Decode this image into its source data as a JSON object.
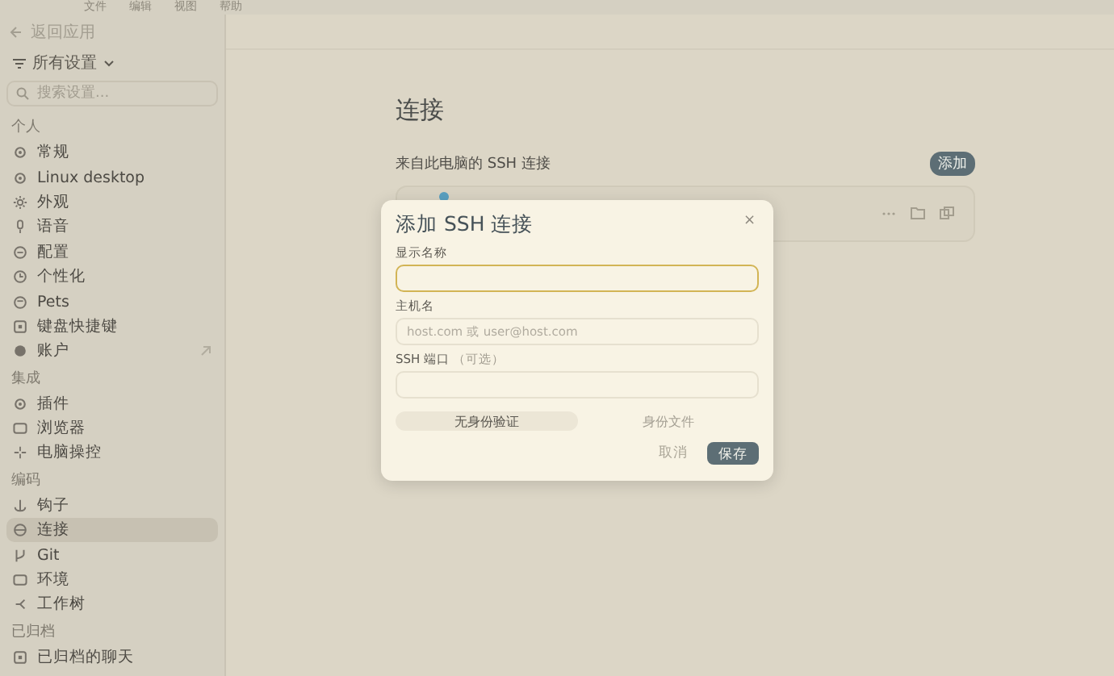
{
  "menu_bar": [
    "文件",
    "编辑",
    "视图",
    "帮助"
  ],
  "sidebar": {
    "back": "返回应用",
    "scope": "所有设置",
    "search": {
      "placeholder": "搜索设置..."
    },
    "sections": [
      {
        "title": "个人",
        "items": [
          {
            "label": "常规",
            "selected": false
          },
          {
            "label": "Linux desktop",
            "selected": false
          },
          {
            "label": "外观",
            "selected": false
          },
          {
            "label": "语音",
            "selected": false
          },
          {
            "label": "配置",
            "selected": false
          },
          {
            "label": "个性化",
            "selected": false
          },
          {
            "label": "Pets",
            "selected": false
          },
          {
            "label": "键盘快捷键",
            "selected": false
          },
          {
            "label": "账户",
            "selected": false,
            "external": true
          }
        ]
      },
      {
        "title": "集成",
        "items": [
          {
            "label": "插件",
            "selected": false
          },
          {
            "label": "浏览器",
            "selected": false
          },
          {
            "label": "电脑操控",
            "selected": false
          }
        ]
      },
      {
        "title": "编码",
        "items": [
          {
            "label": "钩子",
            "selected": false
          },
          {
            "label": "连接",
            "selected": true
          },
          {
            "label": "Git",
            "selected": false
          },
          {
            "label": "环境",
            "selected": false
          },
          {
            "label": "工作树",
            "selected": false
          }
        ]
      },
      {
        "title": "已归档",
        "items": [
          {
            "label": "已归档的聊天",
            "selected": false
          }
        ]
      }
    ]
  },
  "page": {
    "title": "连接",
    "section_label": "来自此电脑的 SSH 连接",
    "add_button": "添加"
  },
  "dialog": {
    "title": "添加 SSH 连接",
    "close": "×",
    "fields": [
      {
        "label": "显示名称",
        "focused": true
      },
      {
        "label": "主机名",
        "placeholder": "host.com 或 user@host.com",
        "focused": false
      },
      {
        "label": "SSH 端口",
        "hint": "（可选）",
        "focused": false
      }
    ],
    "auth_options": [
      {
        "label": "无身份验证",
        "selected": true
      },
      {
        "label": "身份文件",
        "selected": false
      }
    ],
    "cancel": "取消",
    "save": "保存"
  }
}
